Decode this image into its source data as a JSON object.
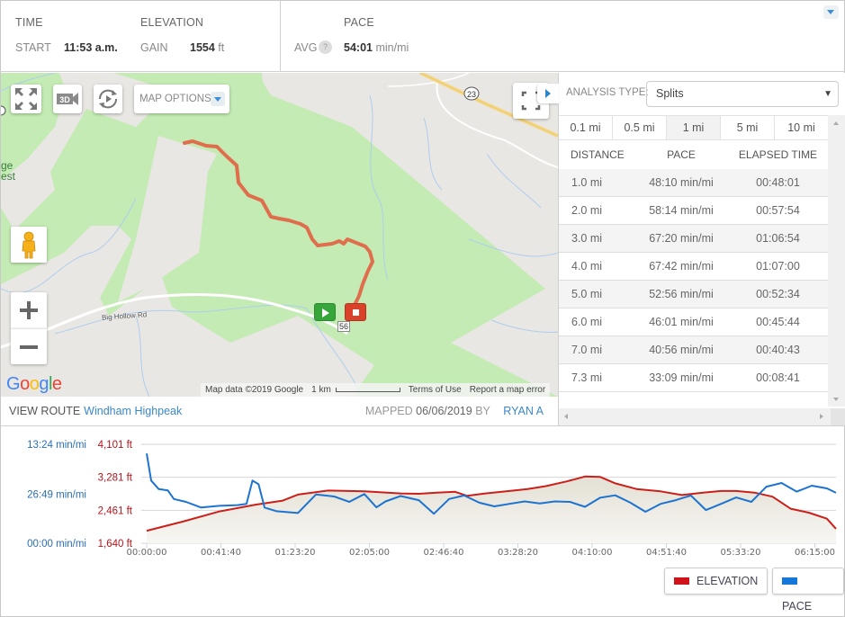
{
  "stats": {
    "time": {
      "heading": "TIME",
      "label": "START",
      "value": "11:53 a.m."
    },
    "elevation": {
      "heading": "ELEVATION",
      "label": "GAIN",
      "value": "1554",
      "unit": "ft"
    },
    "pace": {
      "heading": "PACE",
      "label": "AVG",
      "help_icon": "?",
      "value": "54:01",
      "unit": "min/mi"
    },
    "collapse_icon": "caret-down-icon"
  },
  "map": {
    "controls": {
      "fullscreen_icon": "expand-arrows-icon",
      "three_d_label": "3D",
      "replay_icon": "replay-icon",
      "map_options_label": "MAP OPTIONS",
      "focus_icon": "focus-frame-icon",
      "pegman_icon": "street-view-pegman-icon",
      "zoom_in": "+",
      "zoom_out": "−"
    },
    "place_labels": {
      "forest_partial_1": "ge",
      "forest_partial_2": "est",
      "road": "Big Hollow Rd",
      "route_shield": "23",
      "route_marker": "56"
    },
    "google_logo": "Google",
    "attribution": {
      "map_data": "Map data ©2019 Google",
      "scale": "1 km",
      "terms": "Terms of Use",
      "report": "Report a map error"
    }
  },
  "route": {
    "view_label": "VIEW ROUTE",
    "name": "Windham Highpeak",
    "mapped_label": "MAPPED",
    "mapped_date": "06/06/2019",
    "by_label": "BY",
    "author": "RYAN A"
  },
  "analysis": {
    "type_label": "ANALYSIS TYPE:",
    "type_value": "Splits",
    "segments": [
      "0.1 mi",
      "0.5 mi",
      "1 mi",
      "5 mi",
      "10 mi"
    ],
    "active_segment": "1 mi",
    "columns": [
      "DISTANCE",
      "PACE",
      "ELAPSED TIME"
    ],
    "rows": [
      [
        "1.0 mi",
        "48:10 min/mi",
        "00:48:01"
      ],
      [
        "2.0 mi",
        "58:14 min/mi",
        "00:57:54"
      ],
      [
        "3.0 mi",
        "67:20 min/mi",
        "01:06:54"
      ],
      [
        "4.0 mi",
        "67:42 min/mi",
        "01:07:00"
      ],
      [
        "5.0 mi",
        "52:56 min/mi",
        "00:52:34"
      ],
      [
        "6.0 mi",
        "46:01 min/mi",
        "00:45:44"
      ],
      [
        "7.0 mi",
        "40:56 min/mi",
        "00:40:43"
      ],
      [
        "7.3 mi",
        "33:09 min/mi",
        "00:08:41"
      ]
    ]
  },
  "chart_data": {
    "type": "line",
    "title": "",
    "x_ticks": [
      "00:00:00",
      "00:41:40",
      "01:23:20",
      "02:05:00",
      "02:46:40",
      "03:28:20",
      "04:10:00",
      "04:51:40",
      "05:33:20",
      "06:15:00"
    ],
    "x_range_seconds": [
      0,
      22800
    ],
    "y_left_pace_ticks": [
      "13:24 min/mi",
      "26:49 min/mi",
      "00:00 min/mi"
    ],
    "y_right_elev_ticks": [
      "4,101 ft",
      "3,281 ft",
      "2,461 ft",
      "1,640 ft"
    ],
    "elevation_range_ft": [
      1640,
      4101
    ],
    "grid": true,
    "legend": {
      "placement": "bottom-right",
      "items": [
        {
          "name": "ELEVATION",
          "color": "#d0121b"
        },
        {
          "name": "PACE",
          "color": "#1577d8"
        }
      ]
    },
    "series": [
      {
        "name": "ELEVATION",
        "unit": "ft",
        "color": "#cc1f1a",
        "fill": "#e7e5dc",
        "x_seconds": [
          0,
          1200,
          2400,
          3600,
          4500,
          5000,
          6000,
          7200,
          8400,
          9000,
          9600,
          10200,
          10600,
          11200,
          12000,
          12600,
          13200,
          13900,
          14500,
          15000,
          15500,
          16200,
          17000,
          17700,
          18400,
          19000,
          19500,
          20100,
          20700,
          21300,
          21900,
          22500,
          22800
        ],
        "values": [
          1950,
          2180,
          2430,
          2600,
          2700,
          2850,
          2950,
          2930,
          2880,
          2870,
          2900,
          2920,
          2820,
          2880,
          2940,
          2990,
          3060,
          3180,
          3300,
          3290,
          3130,
          2990,
          2930,
          2840,
          2900,
          2940,
          2940,
          2900,
          2800,
          2500,
          2400,
          2250,
          2000
        ]
      },
      {
        "name": "PACE",
        "unit": "min/mi (axis 0 at bottom to 40:13 at top; 26:49 mid-gridline)",
        "color": "#1d73d0",
        "x_seconds": [
          0,
          150,
          400,
          700,
          900,
          1300,
          1800,
          2400,
          3000,
          3300,
          3500,
          3700,
          3900,
          4300,
          5000,
          5600,
          6200,
          6700,
          7200,
          7600,
          7900,
          8400,
          9000,
          9500,
          10000,
          10500,
          11000,
          11500,
          12000,
          12500,
          13000,
          13500,
          14000,
          14500,
          15000,
          15500,
          16000,
          16500,
          17000,
          17500,
          18000,
          18500,
          19000,
          19500,
          20000,
          20500,
          21000,
          21500,
          22000,
          22500,
          22800
        ],
        "values_min": [
          36.5,
          25.5,
          22.0,
          21.5,
          18.0,
          16.8,
          14.5,
          15.2,
          15.5,
          16.0,
          25.5,
          24.0,
          14.5,
          13.0,
          12.3,
          19.8,
          19.0,
          16.8,
          20.0,
          14.6,
          17.0,
          19.2,
          17.5,
          12.0,
          18.0,
          19.4,
          16.5,
          15.0,
          16.0,
          17.0,
          16.2,
          17.0,
          16.8,
          14.8,
          18.5,
          19.5,
          16.5,
          12.8,
          16.0,
          17.5,
          19.4,
          13.5,
          16.0,
          18.6,
          16.8,
          23.0,
          24.5,
          21.0,
          23.4,
          22.3,
          20.5
        ]
      }
    ]
  }
}
